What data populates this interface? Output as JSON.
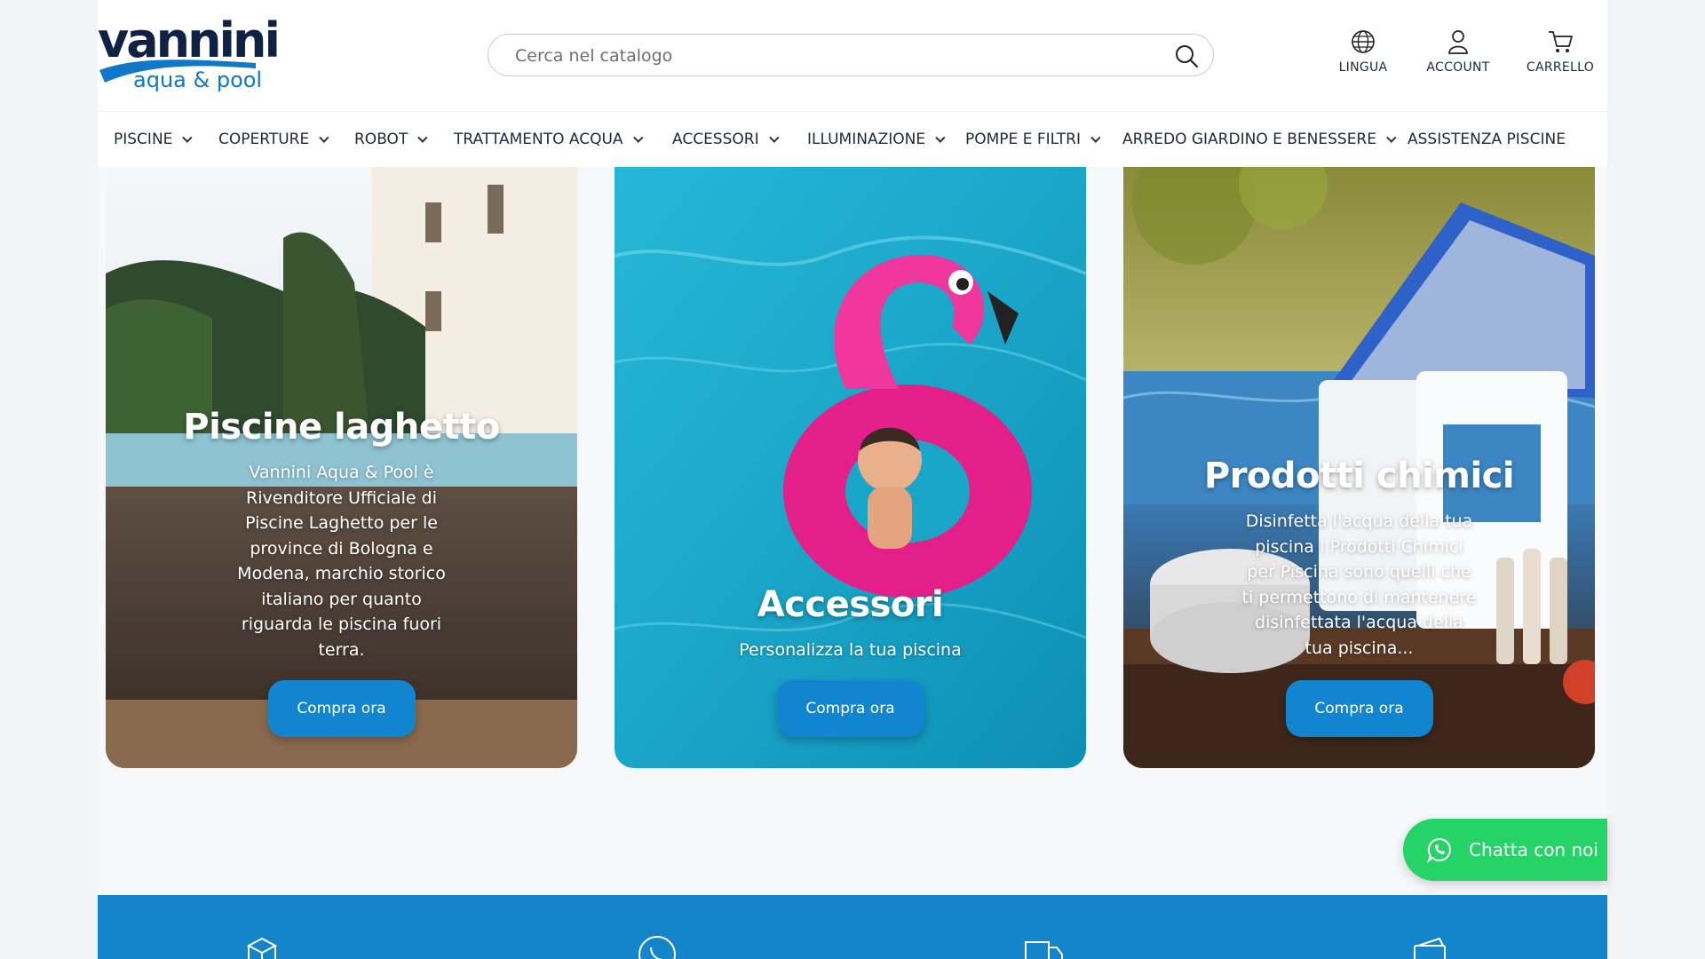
{
  "brand": {
    "logo_main": "vannini",
    "logo_sub": "aqua & pool"
  },
  "search": {
    "placeholder": "Cerca nel catalogo"
  },
  "header_actions": {
    "language": "LINGUA",
    "account": "ACCOUNT",
    "cart": "CARRELLO"
  },
  "nav": {
    "items": [
      {
        "label": "PISCINE",
        "has_dropdown": true
      },
      {
        "label": "COPERTURE",
        "has_dropdown": true
      },
      {
        "label": "ROBOT",
        "has_dropdown": true
      },
      {
        "label": "TRATTAMENTO ACQUA",
        "has_dropdown": true
      },
      {
        "label": "ACCESSORI",
        "has_dropdown": true
      },
      {
        "label": "ILLUMINAZIONE",
        "has_dropdown": true
      },
      {
        "label": "POMPE E FILTRI",
        "has_dropdown": true
      },
      {
        "label": "ARREDO GIARDINO E BENESSERE",
        "has_dropdown": true
      },
      {
        "label": "ASSISTENZA PISCINE",
        "has_dropdown": false
      }
    ]
  },
  "cards": [
    {
      "title": "Piscine laghetto",
      "text": "Vannini Aqua & Pool è Rivenditore Ufficiale di Piscine Laghetto per le province di Bologna e Modena, marchio storico italiano per quanto riguarda le piscina fuori terra.",
      "button": "Compra ora"
    },
    {
      "title": "Accessori",
      "text": "Personalizza la tua piscina",
      "button": "Compra ora"
    },
    {
      "title": "Prodotti chimici",
      "text": "Disinfetta l'acqua della tua piscina I Prodotti Chimici per Piscina sono quelli che ti permettono di mantenere disinfettata l'acqua della tua piscina...",
      "button": "Compra ora"
    }
  ],
  "chat": {
    "label": "Chatta con noi"
  },
  "colors": {
    "brand_blue": "#1185d0",
    "band_blue": "#1385c8",
    "whatsapp_green": "#25d366",
    "logo_navy": "#0f2244"
  },
  "icons": [
    "search-icon",
    "globe-icon",
    "user-icon",
    "cart-icon",
    "chevron-down-icon",
    "whatsapp-icon",
    "box-icon",
    "phone-icon",
    "truck-icon",
    "wallet-icon"
  ]
}
